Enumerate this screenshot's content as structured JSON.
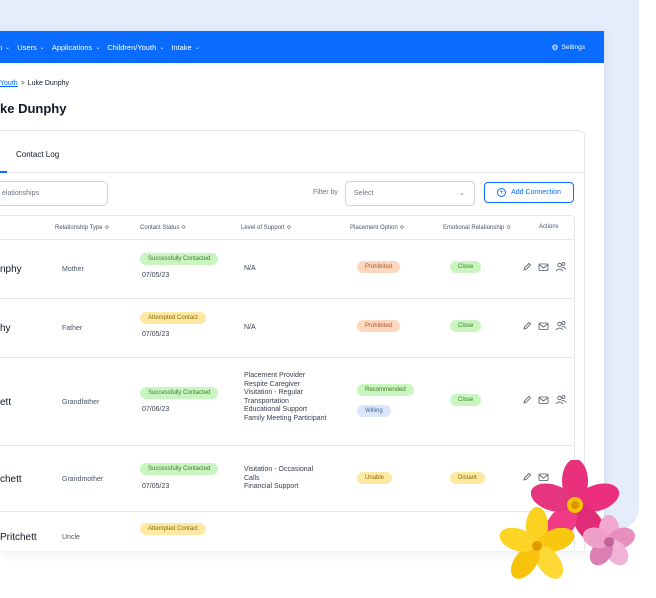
{
  "nav": {
    "items": [
      {
        "label": "n"
      },
      {
        "label": "Users"
      },
      {
        "label": "Applications"
      },
      {
        "label": "Children/Youth"
      },
      {
        "label": "Intake"
      }
    ],
    "settings_label": "Settings"
  },
  "breadcrumb": {
    "parent": "Youth",
    "current": "Luke Dunphy"
  },
  "page_title": "ke Dunphy",
  "tabs": {
    "contact_log": "Contact Log"
  },
  "toolbar": {
    "search_placeholder": "elationships",
    "filter_label": "Filter by",
    "filter_value": "Select",
    "add_label": "Add Connection"
  },
  "table": {
    "headers": {
      "relationship_type": "Relationship Type ≎",
      "contact_status": "Contact Status ≎",
      "level_of_support": "Level of Support ≎",
      "placement_option": "Placement Option ≎",
      "emotional_relationship": "Emotional Relationship ≎",
      "actions": "Actions"
    },
    "rows": [
      {
        "name": "nphy",
        "relationship": "Mother",
        "status": "Successfully Contacted",
        "date": "07/05/23",
        "support": [
          "N/A"
        ],
        "placement": [
          "Prohibited"
        ],
        "emotional": "Close"
      },
      {
        "name": "hy",
        "relationship": "Father",
        "status": "Attempted Contact",
        "date": "07/05/23",
        "support": [
          "N/A"
        ],
        "placement": [
          "Prohibited"
        ],
        "emotional": "Close"
      },
      {
        "name": "ett",
        "relationship": "Grandfather",
        "status": "Successfully Contacted",
        "date": "07/06/23",
        "support": [
          "Placement Provider",
          "Respite Caregiver",
          "Visitation - Regular",
          "Transportation",
          "Educational Support",
          "Family Meeting Participant"
        ],
        "placement": [
          "Recommended",
          "Willing"
        ],
        "emotional": "Close"
      },
      {
        "name": "chett",
        "relationship": "Grandmother",
        "status": "Successfully Contacted",
        "date": "07/05/23",
        "support": [
          "Visitation - Occasional",
          "Calls",
          "Financial Support"
        ],
        "placement": [
          "Unable"
        ],
        "emotional": "Distant"
      },
      {
        "name": "Pritchett",
        "relationship": "Uncle",
        "status": "Attempted Contact",
        "date": "",
        "support": [],
        "placement": [],
        "emotional": ""
      }
    ]
  },
  "colors": {
    "brand": "#0a6cff",
    "backdrop": "#e5edfb"
  },
  "icons": {
    "edit": "pencil-icon",
    "message": "envelope-icon",
    "people": "people-icon",
    "settings": "gear-icon",
    "add": "plus-circle-icon"
  }
}
